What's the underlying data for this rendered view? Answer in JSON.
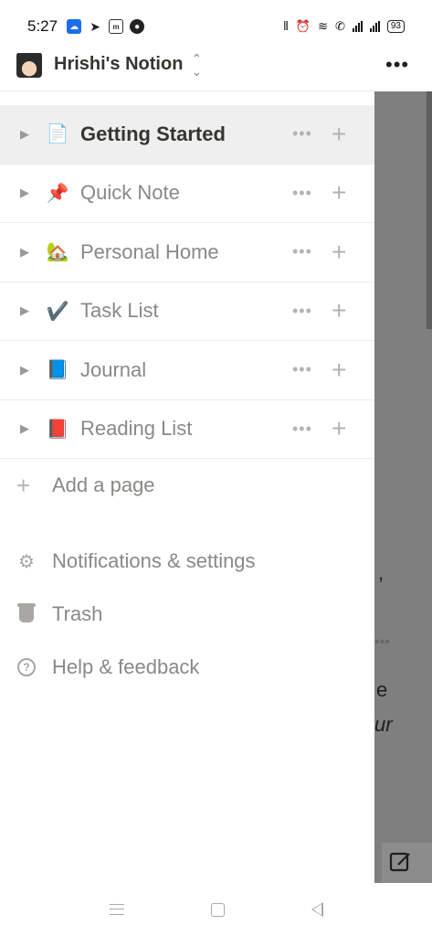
{
  "status_bar": {
    "time": "5:27",
    "battery": "93"
  },
  "workspace": {
    "name": "Hrishi's Notion"
  },
  "pages": [
    {
      "emoji": "📄",
      "label": "Getting Started",
      "active": true
    },
    {
      "emoji": "📌",
      "label": "Quick Note",
      "active": false
    },
    {
      "emoji": "🏡",
      "label": "Personal Home",
      "active": false
    },
    {
      "emoji": "✔️",
      "label": "Task List",
      "active": false
    },
    {
      "emoji": "📘",
      "label": "Journal",
      "active": false
    },
    {
      "emoji": "📕",
      "label": "Reading List",
      "active": false
    }
  ],
  "row_actions": {
    "more": "•••",
    "add": "+"
  },
  "add_page": {
    "plus": "+",
    "label": "Add a page"
  },
  "utilities": {
    "settings": "Notifications & settings",
    "trash": "Trash",
    "help": "Help & feedback"
  },
  "background_page": {
    "more": "•••",
    "fragments": [
      ",",
      "•••",
      "e",
      "ur"
    ]
  }
}
